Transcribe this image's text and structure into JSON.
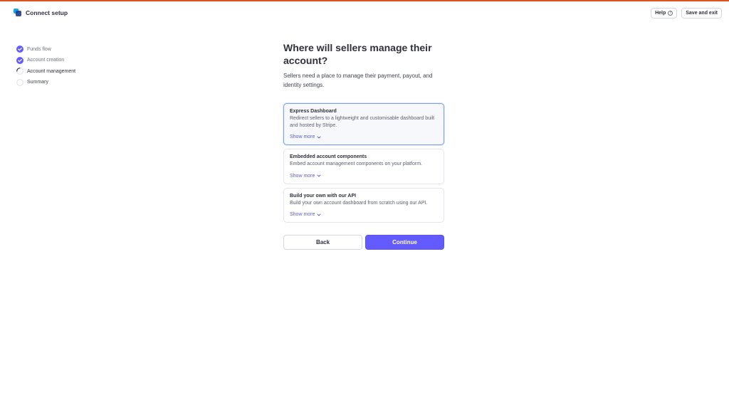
{
  "app": {
    "title": "Connect setup",
    "accent_color": "#d9541e",
    "brand_color": "#635bff"
  },
  "header": {
    "help_label": "Help",
    "save_exit_label": "Save and exit"
  },
  "steps": [
    {
      "label": "Funds flow",
      "status": "done"
    },
    {
      "label": "Account creation",
      "status": "done"
    },
    {
      "label": "Account management",
      "status": "current"
    },
    {
      "label": "Summary",
      "status": "todo"
    }
  ],
  "main": {
    "title": "Where will sellers manage their account?",
    "subtitle": "Sellers need a place to manage their payment, payout, and identity settings.",
    "options": [
      {
        "title": "Express Dashboard",
        "description": "Redirect sellers to a lightweight and customisable dashboard built and hosted by Stripe.",
        "show_more": "Show more",
        "selected": true
      },
      {
        "title": "Embedded account components",
        "description": "Embed account management components on your platform.",
        "show_more": "Show more",
        "selected": false
      },
      {
        "title": "Build your own with our API",
        "description": "Build your own account dashboard from scratch using our API.",
        "show_more": "Show more",
        "selected": false
      }
    ],
    "back_label": "Back",
    "continue_label": "Continue"
  }
}
